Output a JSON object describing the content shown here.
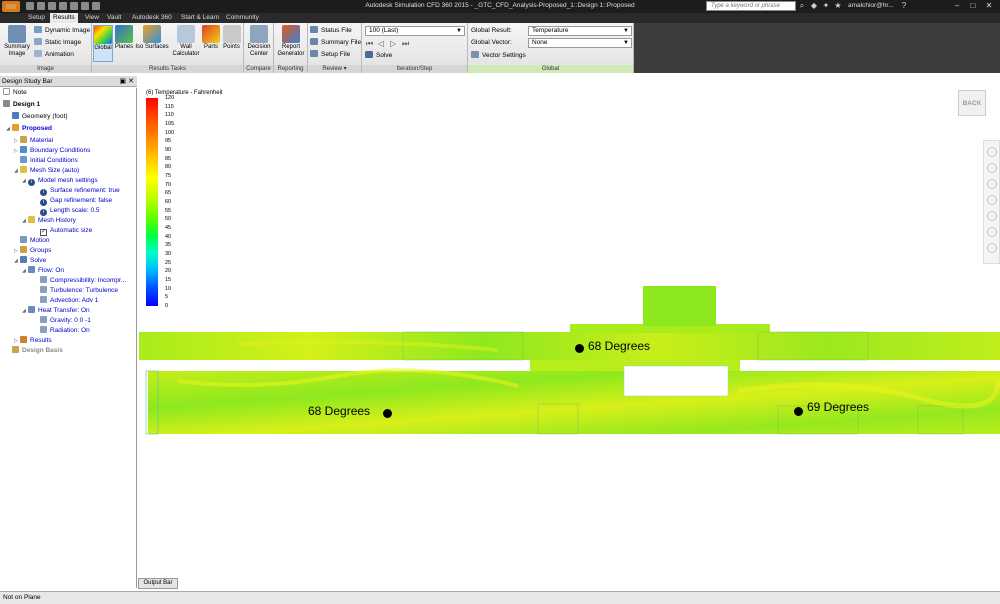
{
  "app": {
    "title": "Autodesk Simulation CFD 360 2015 - _GTC_CFD_Analysis-Proposed_1::Design 1::Proposed",
    "logo_label": "CFD 360",
    "search_placeholder": "Type a keyword or phrase",
    "user": "amalchior@hr..."
  },
  "tabs": [
    "Setup",
    "Results",
    "View",
    "Vault",
    "Autodesk 360",
    "Start & Learn",
    "Community"
  ],
  "active_tab": "Results",
  "ribbon": {
    "image": {
      "title": "Image",
      "summary_image": "Summary Image",
      "dynamic_image": "Dynamic Image",
      "static_image": "Static Image",
      "animation": "Animation"
    },
    "results_tasks": {
      "title": "Results Tasks",
      "global": "Global",
      "planes": "Planes",
      "iso_surfaces": "Iso Surfaces",
      "wall_calculator": "Wall Calculator",
      "parts": "Parts",
      "points": "Points"
    },
    "compare": {
      "title": "Compare",
      "decision_center": "Decision Center"
    },
    "reporting": {
      "title": "Reporting",
      "report_generator": "Report Generator"
    },
    "review": {
      "title": "Review",
      "status_file": "Status File",
      "summary_file": "Summary File",
      "setup_file": "Setup File"
    },
    "iteration_step": {
      "title": "Iteration/Step",
      "current": "100 (Last)",
      "solve": "Solve"
    },
    "global": {
      "title": "Global",
      "global_result_label": "Global Result:",
      "global_result_value": "Temperature",
      "global_vector_label": "Global Vector:",
      "global_vector_value": "None",
      "vector_settings": "Vector Settings"
    }
  },
  "sidebar": {
    "title": "Design Study Bar",
    "tree": [
      {
        "label": "Note",
        "style": "black"
      },
      {
        "label": "Design 1",
        "style": "black-bold"
      },
      {
        "label": "Geometry (foot)",
        "style": "black"
      },
      {
        "label": "Proposed",
        "style": "bold"
      },
      {
        "label": "Material"
      },
      {
        "label": "Boundary Conditions"
      },
      {
        "label": "Initial Conditions"
      },
      {
        "label": "Mesh Size (auto)"
      },
      {
        "label": "Model mesh settings"
      },
      {
        "label": "Surface refinement: true"
      },
      {
        "label": "Gap refinement: false"
      },
      {
        "label": "Length scale: 0.5"
      },
      {
        "label": "Mesh History"
      },
      {
        "label": "Automatic size"
      },
      {
        "label": "Motion"
      },
      {
        "label": "Groups"
      },
      {
        "label": "Solve"
      },
      {
        "label": "Flow: On"
      },
      {
        "label": "Compressibility: Incompr..."
      },
      {
        "label": "Turbulence: Turbulence"
      },
      {
        "label": "Advection: Adv 1"
      },
      {
        "label": "Heat Transfer: On"
      },
      {
        "label": "Gravity: 0 0 -1"
      },
      {
        "label": "Radiation: On"
      },
      {
        "label": "Results"
      },
      {
        "label": "Design Basis",
        "style": "grey"
      }
    ]
  },
  "legend": {
    "title": "(6) Temperature - Fahrenheit",
    "ticks": [
      "120",
      "115",
      "110",
      "105",
      "100",
      "95",
      "90",
      "85",
      "80",
      "75",
      "70",
      "65",
      "60",
      "55",
      "50",
      "45",
      "40",
      "35",
      "30",
      "25",
      "20",
      "15",
      "10",
      "5",
      "0"
    ]
  },
  "probes": [
    {
      "label": "68 Degrees"
    },
    {
      "label": "68 Degrees"
    },
    {
      "label": "69 Degrees"
    }
  ],
  "viewport": {
    "back_label": "BACK"
  },
  "output_bar": "Output Bar",
  "status": "Not on Plane",
  "colors": {
    "field_green": "#8ee81e",
    "field_yellow": "#d8f01a",
    "field_lime": "#b6ee1c"
  }
}
